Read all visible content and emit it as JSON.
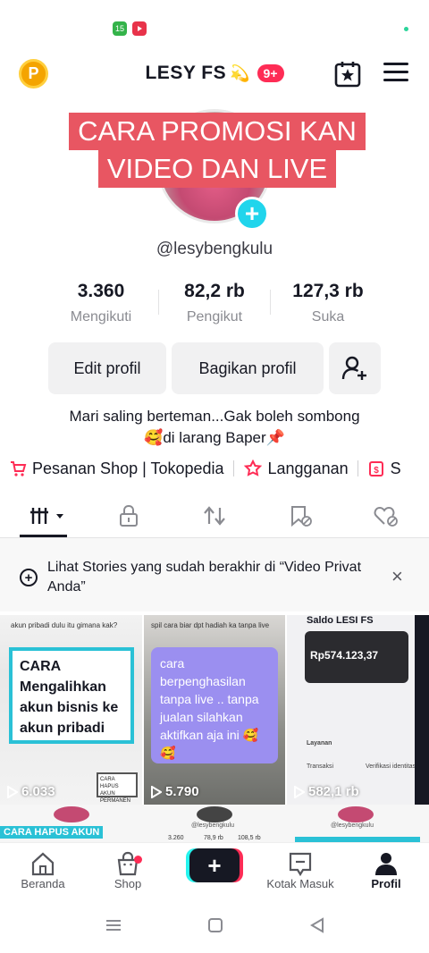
{
  "status_bar": {
    "icons": [
      "app-notification-green-icon",
      "youtube-icon"
    ],
    "green_icon_text": "15"
  },
  "header": {
    "coin_label": "P",
    "username": "LESY FS",
    "username_emoji": "💫",
    "notification_badge": "9+",
    "icons": [
      "favorites-icon",
      "menu-icon"
    ]
  },
  "profile": {
    "banner_line_1": "CARA PROMOSI KAN",
    "banner_line_2": "VIDEO DAN LIVE",
    "add_label": "+",
    "handle": "@lesybengkulu"
  },
  "stats": [
    {
      "value": "3.360",
      "label": "Mengikuti"
    },
    {
      "value": "82,2 rb",
      "label": "Pengikut"
    },
    {
      "value": "127,3 rb",
      "label": "Suka"
    }
  ],
  "buttons": {
    "edit": "Edit profil",
    "share": "Bagikan profil"
  },
  "bio": {
    "line1": "Mari saling berteman...Gak boleh sombong",
    "line2": "🥰di larang Baper📌"
  },
  "links": [
    {
      "label": "Pesanan Shop | Tokopedia",
      "icon": "shopping-cart-icon"
    },
    {
      "label": "Langganan",
      "icon": "subscription-icon"
    },
    {
      "label": "S",
      "icon": "wallet-icon"
    }
  ],
  "tabs": [
    "videos-grid-icon",
    "private-lock-icon",
    "repost-icon",
    "saved-icon",
    "liked-icon"
  ],
  "stories": {
    "text": "Lihat Stories yang sudah berakhir di “Video Privat Anda”",
    "close": "×"
  },
  "videos": [
    {
      "views": "6.033",
      "overlay": "CARA Mengalihkan akun bisnis ke akun pribadi",
      "top_text": "akun pribadi dulu itu gimana kak?",
      "tag": "CARA HAPUS AKUN PERMANEN"
    },
    {
      "views": "5.790",
      "overlay": "cara berpenghasilan tanpa live .. tanpa jualan silahkan aktifkan aja ini 🥰🥰",
      "top_text": "spil cara biar dpt hadiah ka tanpa live"
    },
    {
      "views": "582,1 rb",
      "title": "Saldo LESI FS",
      "amount": "Rp574.123,37",
      "rows": [
        "Layanan",
        "Transaksi",
        "Verifikasi identitas"
      ]
    }
  ],
  "row2": {
    "label": "CARA HAPUS AKUN",
    "small_texts": [
      "@lesybengkulu",
      "3.260",
      "78,9 rb",
      "108,5 rb",
      "@lesybengkulu"
    ]
  },
  "bottom_nav": [
    {
      "label": "Beranda",
      "icon": "home-icon"
    },
    {
      "label": "Shop",
      "icon": "shop-bag-icon"
    },
    {
      "label": "+",
      "icon": "create-plus-icon"
    },
    {
      "label": "Kotak Masuk",
      "icon": "inbox-icon"
    },
    {
      "label": "Profil",
      "icon": "profile-person-icon"
    }
  ],
  "colors": {
    "accent": "#fe2c55",
    "cyan": "#25f4ee",
    "banner": "#e85662",
    "coin": "#f4a400"
  }
}
